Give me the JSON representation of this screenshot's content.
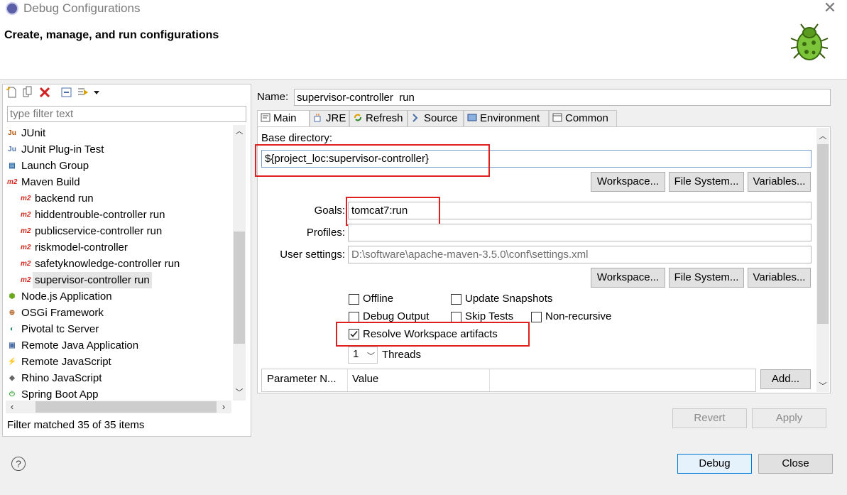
{
  "window": {
    "title": "Debug Configurations"
  },
  "header": {
    "title": "Create, manage, and run configurations"
  },
  "left": {
    "filter_placeholder": "type filter text",
    "tree": [
      {
        "label": "JUnit",
        "icon": "junit-icon",
        "level": 0
      },
      {
        "label": "JUnit Plug-in Test",
        "icon": "junit-plugin-icon",
        "level": 0
      },
      {
        "label": "Launch Group",
        "icon": "launch-group-icon",
        "level": 0
      },
      {
        "label": "Maven Build",
        "icon": "m2-icon",
        "level": 0
      },
      {
        "label": "backend run",
        "icon": "m2-icon",
        "level": 1
      },
      {
        "label": "hiddentrouble-controller run",
        "icon": "m2-icon",
        "level": 1
      },
      {
        "label": "publicservice-controller run",
        "icon": "m2-icon",
        "level": 1
      },
      {
        "label": "riskmodel-controller",
        "icon": "m2-icon",
        "level": 1
      },
      {
        "label": "safetyknowledge-controller run",
        "icon": "m2-icon",
        "level": 1
      },
      {
        "label": "supervisor-controller  run",
        "icon": "m2-icon",
        "level": 1,
        "selected": true
      },
      {
        "label": "Node.js Application",
        "icon": "nodejs-icon",
        "level": 0
      },
      {
        "label": "OSGi Framework",
        "icon": "osgi-icon",
        "level": 0
      },
      {
        "label": "Pivotal tc Server",
        "icon": "pivotal-icon",
        "level": 0
      },
      {
        "label": "Remote Java Application",
        "icon": "remote-java-icon",
        "level": 0
      },
      {
        "label": "Remote JavaScript",
        "icon": "remote-js-icon",
        "level": 0
      },
      {
        "label": "Rhino JavaScript",
        "icon": "rhino-icon",
        "level": 0
      },
      {
        "label": "Spring Boot App",
        "icon": "spring-boot-icon",
        "level": 0
      }
    ],
    "status": "Filter matched 35 of 35 items"
  },
  "right": {
    "name_label": "Name:",
    "name_value": "supervisor-controller  run",
    "tabs": [
      {
        "label": "Main",
        "active": true
      },
      {
        "label": "JRE"
      },
      {
        "label": "Refresh"
      },
      {
        "label": "Source"
      },
      {
        "label": "Environment"
      },
      {
        "label": "Common"
      }
    ],
    "base_dir_label": "Base directory:",
    "base_dir_value": "${project_loc:supervisor-controller}",
    "workspace_btn": "Workspace...",
    "filesystem_btn": "File System...",
    "variables_btn": "Variables...",
    "goals_label": "Goals:",
    "goals_value": "tomcat7:run",
    "profiles_label": "Profiles:",
    "profiles_value": "",
    "user_settings_label": "User settings:",
    "user_settings_value": "D:\\software\\apache-maven-3.5.0\\conf\\settings.xml",
    "offline_label": "Offline",
    "update_snapshots_label": "Update Snapshots",
    "debug_output_label": "Debug Output",
    "skip_tests_label": "Skip Tests",
    "non_recursive_label": "Non-recursive",
    "resolve_ws_label": "Resolve Workspace artifacts",
    "resolve_ws_checked": true,
    "threads_value": "1",
    "threads_label": "Threads",
    "param_col1": "Parameter N...",
    "param_col2": "Value",
    "add_btn": "Add...",
    "revert_btn": "Revert",
    "apply_btn": "Apply"
  },
  "footer": {
    "debug_btn": "Debug",
    "close_btn": "Close"
  },
  "colors": {
    "highlight": "#e02020",
    "selection": "#e5e5e5"
  }
}
